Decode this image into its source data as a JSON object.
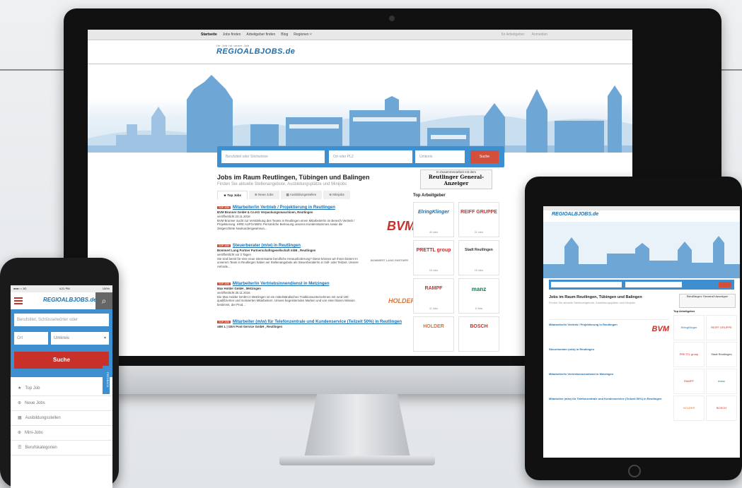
{
  "desktop": {
    "nav": [
      "Startseite",
      "Jobs finden",
      "Arbeitgeber finden",
      "Blog",
      "Regionen ˅"
    ],
    "nav_right": [
      "für Arbeitgeber",
      "Anmelden"
    ],
    "logo": "REGIOALBJOBS.de",
    "logo_tagline": "Ihr Job ist unser Job",
    "search_placeholder_what": "Berufstitel oder Stichwörter",
    "search_placeholder_where": "Ort oder PLZ",
    "search_radius": "Umkreis",
    "search_button": "Suche",
    "headline": "Jobs im Raum Reutlingen, Tübingen und Balingen",
    "subheadline": "Finden Sie aktuelle Stellenangebote, Ausbildungsplätze und Minijobs",
    "tabs": [
      "★ Top Jobs",
      "⊕ Neue Jobs",
      "▦ Ausbildungsstellen",
      "⊕ Minijobs"
    ],
    "jobs": [
      {
        "tag": "TOP JOB",
        "title": "Mitarbeiter/in Vertrieb / Projektierung in Reutlingen",
        "company": "BVM Brunner GmbH & Co.KG Verpackungsmaschinen, Reutlingen",
        "date": "veröffentlicht 23.11.2016",
        "text": "BVM Brunner sucht zur Verstärkung des Teams in Reutlingen einen Mitarbeiter/in im Bereich Vertrieb / Projektierung. IHRE AUFGABEN: Persönliche Betreuung unseres Kundenstammes sowie die zielgerichtete Neukundengewinnun...",
        "logo": "BVM"
      },
      {
        "tag": "TOP JOB",
        "title": "Steuerberater (m/w) in Reutlingen",
        "company": "Bommert Lang Partner Partnerschaftsgesellschaft mbB , Reutlingen",
        "date": "veröffentlicht vor 2 Tagen",
        "text": "Sie sind bereit für eine neue interessante berufliche Herausforderung? Diese können wir Ihnen bieten! In unserem Team in Reutlingen haben wir Stellenangebote als Steuerberater/in in Voll- oder Teilzeit. Unsere Anforde...",
        "logo": "BOMMERT LANG PARTNER"
      },
      {
        "tag": "TOP JOB",
        "title": "Mitarbeiter/in Vertriebsinnendienst in Metzingen",
        "company": "Max Holder GmbH , Metzingen",
        "date": "veröffentlicht 30.11.2016",
        "text": "Die Max Holder GmbH in Metzingen ist ein mittelständisches Traditionsunternehmen mit rund 100 qualifizierten und motivierten Mitarbeitern. Unsere begeisternden Marken und von einer klaren Mission bestimmt, der Prod...",
        "logo": "HOLDER"
      },
      {
        "tag": "TOP JOB",
        "title": "Mitarbeiter (m/w) für Telefonzentrale und Kundenservice (Teilzeit 50%) in Reutlingen",
        "company": "sBK L | GEA Post-Service GmbH , Reutlingen",
        "date": "",
        "text": "",
        "logo": ""
      }
    ],
    "side_ad_top": "In Zusammenarbeit mit dem",
    "side_ad_name": "Reutlinger General-Anzeiger",
    "top_employers_title": "Top Arbeitgeber",
    "top_employers": [
      {
        "name": "ElringKlinger",
        "jobs": "40 Jobs"
      },
      {
        "name": "REIFF GRUPPE",
        "jobs": "21 Jobs"
      },
      {
        "name": "PRETTL group",
        "jobs": "18 Jobs"
      },
      {
        "name": "Stadt Reutlingen",
        "jobs": "15 Jobs"
      },
      {
        "name": "RAMPF",
        "jobs": "11 Jobs"
      },
      {
        "name": "manz",
        "jobs": "6 Jobs"
      },
      {
        "name": "HOLDER",
        "jobs": ""
      },
      {
        "name": "BOSCH",
        "jobs": ""
      }
    ]
  },
  "phone": {
    "status_carrier": "●●●○○ 3G",
    "status_time": "4:21 PM",
    "status_battery": "100%",
    "logo": "REGIOALBJOBS.de",
    "search_placeholder": "Berufstitel, Schlüsselwörter oder",
    "ort_placeholder": "Ort",
    "umkreis": "Umkreis",
    "search_button": "Suche",
    "feedback": "FEEDBACK",
    "menu": [
      {
        "icon": "★",
        "label": "Top Job"
      },
      {
        "icon": "⊕",
        "label": "Neue Jobs"
      },
      {
        "icon": "▦",
        "label": "Ausbildungsstellen"
      },
      {
        "icon": "⊕",
        "label": "Mini-Jobs"
      },
      {
        "icon": "☰",
        "label": "Berufskategorien"
      }
    ]
  },
  "tablet": {
    "headline": "Jobs im Raum Reutlingen, Tübingen und Balingen",
    "subheadline": "Finden Sie aktuelle Stellenangebote, Ausbildungsplätze und Minijobs",
    "top_employers_title": "Top Arbeitgeber"
  }
}
